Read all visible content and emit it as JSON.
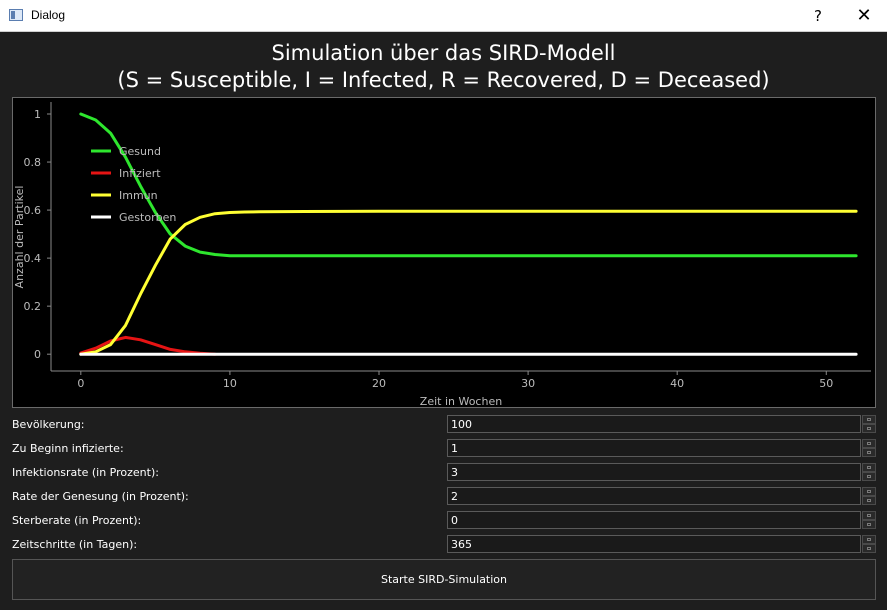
{
  "window": {
    "title": "Dialog",
    "help_glyph": "?",
    "close_glyph": "✕"
  },
  "chart": {
    "title_line1": "Simulation über das SIRD-Modell",
    "title_line2": "(S = Susceptible, I = Infected, R = Recovered, D = Deceased)"
  },
  "chart_data": {
    "type": "line",
    "title": "Simulation über das SIRD-Modell (S = Susceptible, I = Infected, R = Recovered, D = Deceased)",
    "xlabel": "Zeit in Wochen",
    "ylabel": "Anzahl der Partikel",
    "xlim": [
      -2,
      53
    ],
    "ylim": [
      -0.07,
      1.05
    ],
    "xticks": [
      "0",
      "10",
      "20",
      "30",
      "40",
      "50"
    ],
    "yticks": [
      "0",
      "0.2",
      "0.4",
      "0.6",
      "0.8",
      "1"
    ],
    "grid": false,
    "legend_position": "top-left",
    "series": [
      {
        "name": "Gesund",
        "color": "#2ee62e",
        "x": [
          0,
          1,
          2,
          3,
          4,
          5,
          6,
          7,
          8,
          9,
          10,
          11,
          12,
          15,
          20,
          30,
          40,
          52
        ],
        "values": [
          1.0,
          0.975,
          0.92,
          0.82,
          0.7,
          0.59,
          0.5,
          0.45,
          0.425,
          0.415,
          0.41,
          0.41,
          0.41,
          0.41,
          0.41,
          0.41,
          0.41,
          0.41
        ]
      },
      {
        "name": "Infiziert",
        "color": "#e61414",
        "x": [
          0,
          1,
          2,
          3,
          4,
          5,
          6,
          7,
          8,
          9
        ],
        "values": [
          0.005,
          0.025,
          0.055,
          0.07,
          0.06,
          0.04,
          0.02,
          0.01,
          0.004,
          0.0
        ]
      },
      {
        "name": "Immun",
        "color": "#ffff33",
        "x": [
          0,
          1,
          2,
          3,
          4,
          5,
          6,
          7,
          8,
          9,
          10,
          11,
          12,
          15,
          20,
          30,
          40,
          52
        ],
        "values": [
          0.0,
          0.01,
          0.04,
          0.12,
          0.25,
          0.37,
          0.48,
          0.54,
          0.57,
          0.585,
          0.59,
          0.592,
          0.593,
          0.594,
          0.595,
          0.595,
          0.595,
          0.595
        ]
      },
      {
        "name": "Gestorben",
        "color": "#ffffff",
        "x": [
          0,
          52
        ],
        "values": [
          0.0,
          0.0
        ]
      }
    ]
  },
  "form": {
    "population_label": "Bevölkerung:",
    "population_value": "100",
    "initial_infected_label": "Zu Beginn infizierte:",
    "initial_infected_value": "1",
    "infection_rate_label": "Infektionsrate (in Prozent):",
    "infection_rate_value": "3",
    "recovery_rate_label": "Rate der Genesung (in Prozent):",
    "recovery_rate_value": "2",
    "death_rate_label": "Sterberate (in Prozent):",
    "death_rate_value": "0",
    "time_steps_label": "Zeitschritte (in Tagen):",
    "time_steps_value": "365"
  },
  "run_button_label": "Starte SIRD-Simulation"
}
